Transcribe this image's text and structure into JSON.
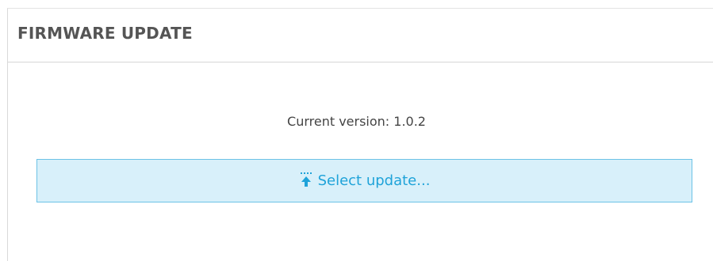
{
  "panel": {
    "title": "FIRMWARE UPDATE"
  },
  "firmware": {
    "current_version_text": "Current version: 1.0.2"
  },
  "upload": {
    "button_label": "Select update...",
    "icon": "upload-icon"
  },
  "colors": {
    "accent": "#1fa3d9",
    "button_bg": "#d8f0fa",
    "button_border": "#6cc2e6",
    "title_text": "#555555",
    "body_text": "#444444"
  }
}
